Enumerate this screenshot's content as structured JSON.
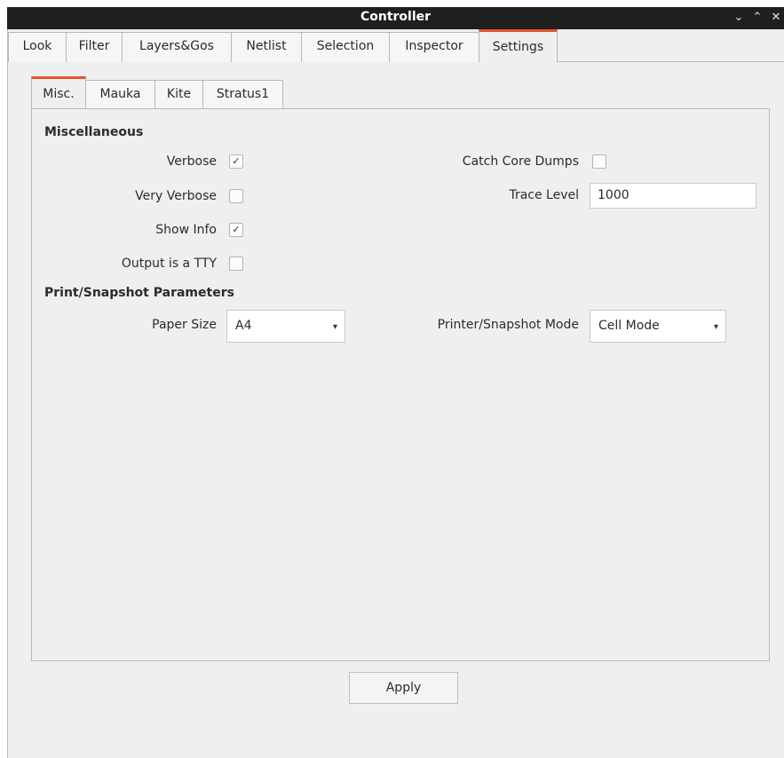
{
  "window": {
    "title": "Controller",
    "controls": {
      "minimize": "⌄",
      "maximize": "⌃",
      "close": "✕"
    }
  },
  "tabs": [
    {
      "label": "Look"
    },
    {
      "label": "Filter"
    },
    {
      "label": "Layers&Gos"
    },
    {
      "label": "Netlist"
    },
    {
      "label": "Selection"
    },
    {
      "label": "Inspector"
    },
    {
      "label": "Settings",
      "active": true
    }
  ],
  "subtabs": [
    {
      "label": "Misc.",
      "active": true
    },
    {
      "label": "Mauka"
    },
    {
      "label": "Kite"
    },
    {
      "label": "Stratus1"
    }
  ],
  "misc": {
    "section_title": "Miscellaneous",
    "verbose": {
      "label": "Verbose",
      "checked": true
    },
    "very_verbose": {
      "label": "Very Verbose",
      "checked": false
    },
    "show_info": {
      "label": "Show Info",
      "checked": true
    },
    "output_tty": {
      "label": "Output is a TTY",
      "checked": false
    },
    "catch_core_dumps": {
      "label": "Catch Core Dumps",
      "checked": false
    },
    "trace_level": {
      "label": "Trace Level",
      "value": "1000"
    }
  },
  "print": {
    "section_title": "Print/Snapshot Parameters",
    "paper_size": {
      "label": "Paper Size",
      "value": "A4"
    },
    "mode": {
      "label": "Printer/Snapshot Mode",
      "value": "Cell Mode"
    }
  },
  "apply_label": "Apply",
  "colors": {
    "accent": "#e8542d",
    "titlebar": "#1f1f1f",
    "background": "#efefef"
  },
  "glyphs": {
    "check": "✓",
    "dropdown": "▾"
  }
}
